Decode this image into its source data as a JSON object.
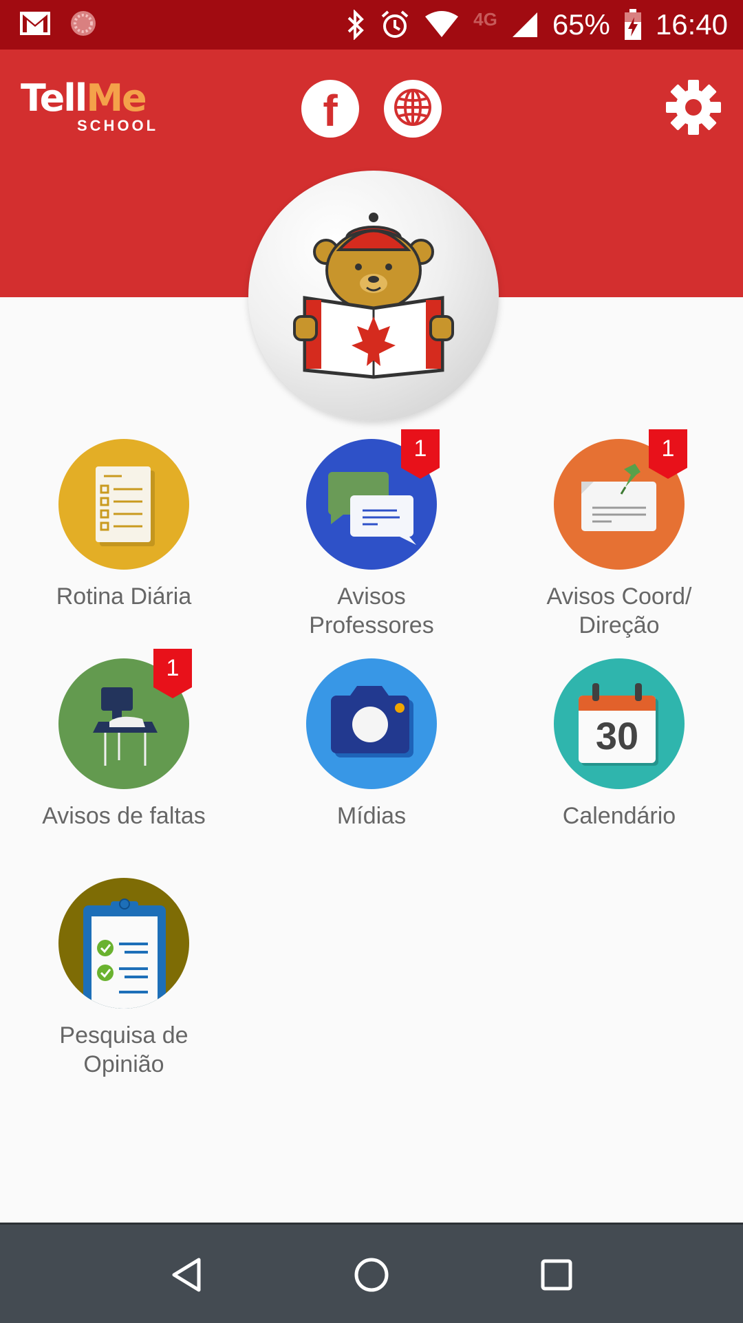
{
  "status_bar": {
    "time": "16:40",
    "battery": "65%",
    "network": "4G",
    "icons": [
      "gmail-icon",
      "sync-icon",
      "bluetooth-icon",
      "alarm-icon",
      "wifi-icon",
      "signal-icon",
      "battery-charging-icon"
    ]
  },
  "header": {
    "logo": {
      "main_a": "Tell",
      "main_b": "Me",
      "sub": "SCHOOL"
    },
    "facebook_icon": "facebook-icon",
    "website_icon": "globe-icon",
    "settings_icon": "gear-icon",
    "background_color": "#d32f2f"
  },
  "profile": {
    "avatar_icon": "bear-reading-canada-icon"
  },
  "menu": [
    {
      "label_lines": [
        "Rotina Diária"
      ],
      "icon": "checklist-document-icon",
      "color": "#e3ae26",
      "badge": null
    },
    {
      "label_lines": [
        "Avisos",
        "Professores"
      ],
      "icon": "chat-bubbles-icon",
      "color": "#2e51c8",
      "badge": "1"
    },
    {
      "label_lines": [
        "Avisos Coord/",
        "Direção"
      ],
      "icon": "pinned-note-icon",
      "color": "#e67133",
      "badge": "1"
    },
    {
      "label_lines": [
        "Avisos de faltas"
      ],
      "icon": "school-desk-icon",
      "color": "#639a4f",
      "badge": "1"
    },
    {
      "label_lines": [
        "Mídias"
      ],
      "icon": "camera-icon",
      "color": "#3897e6",
      "badge": null
    },
    {
      "label_lines": [
        "Calendário"
      ],
      "icon": "calendar-icon",
      "color": "#2fb5ad",
      "badge": null,
      "calendar_day": "30"
    },
    {
      "label_lines": [
        "Pesquisa de",
        "Opinião"
      ],
      "icon": "clipboard-checklist-icon",
      "color": "#7e6c05",
      "badge": null
    }
  ],
  "badge_color": "#e8111a",
  "nav_bar": {
    "buttons": [
      "back-icon",
      "home-icon",
      "recents-icon"
    ]
  }
}
